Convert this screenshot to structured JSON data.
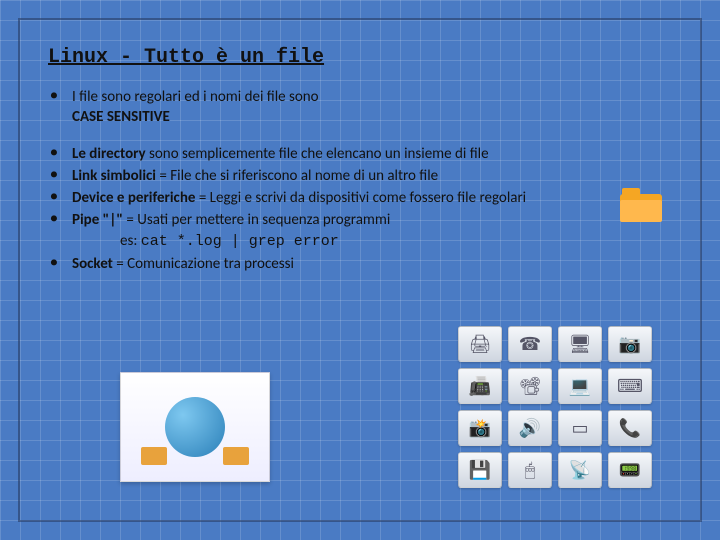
{
  "title": "Linux - Tutto è un file",
  "bullets": {
    "b1_pre": "I file sono regolari ed i nomi dei file sono",
    "b1_strong": "CASE SENSITIVE",
    "b2_strong": "Le directory",
    "b2_rest": " sono semplicemente file che elencano un insieme di file",
    "b3_strong": "Link simbolici",
    "b3_rest": " = File che si riferiscono al nome di un altro file",
    "b4_strong": "Device e periferiche",
    "b4_rest": " = Leggi e scrivi da dispositivi come fossero file regolari",
    "b5_strong": "Pipe \"|\"",
    "b5_rest": " = Usati per mettere in sequenza programmi",
    "b5_ex_label": "es: ",
    "b5_ex_code": "cat *.log | grep error",
    "b6_strong": "Socket",
    "b6_rest": " = Comunicazione tra processi"
  },
  "icons": {
    "folder": "folder-icon",
    "globe": "globe-network-icon",
    "devices": [
      "printer",
      "phone",
      "monitor",
      "webcam",
      "scanner",
      "projector",
      "laptop",
      "keyboard",
      "camera",
      "speaker",
      "tablet",
      "fax",
      "hdd",
      "mouse",
      "router",
      "modem"
    ]
  }
}
